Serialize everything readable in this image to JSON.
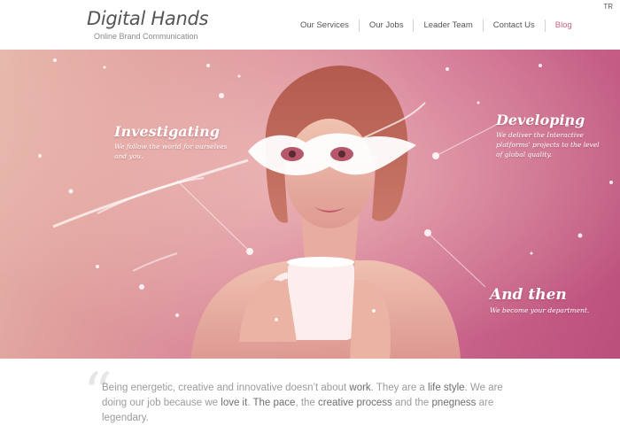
{
  "header": {
    "logo_title": "Digital Hands",
    "logo_subtitle": "Online Brand Communication",
    "language": "TR"
  },
  "nav": {
    "items": [
      {
        "label": "Our Services"
      },
      {
        "label": "Our Jobs"
      },
      {
        "label": "Leader Team"
      },
      {
        "label": "Contact Us"
      },
      {
        "label": "Blog"
      }
    ],
    "active_color": "#c9657a"
  },
  "hero": {
    "callouts": [
      {
        "heading": "Investigating",
        "text": "We follow the world for ourselves and you."
      },
      {
        "heading": "Developing",
        "text": "We deliver the Interactive platforms' projects to the level of global quality."
      },
      {
        "heading": "And then",
        "text": "We become your department."
      }
    ]
  },
  "quote": {
    "mark": "“",
    "parts": [
      "Being energetic, creative and innovative doesn’t about ",
      "work",
      ". They are a ",
      "life style",
      ". We are doing our job because we ",
      "love it",
      ". ",
      "The pace",
      ", the ",
      "creative process",
      " and the ",
      "pnegness",
      " are legendary."
    ]
  }
}
